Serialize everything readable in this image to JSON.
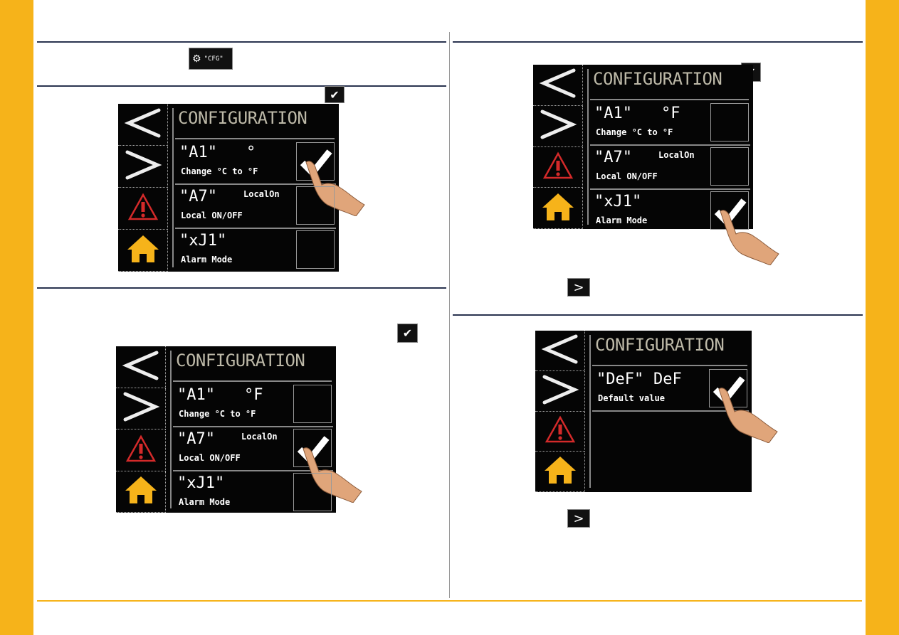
{
  "colors": {
    "accent": "#f6b31a",
    "screen_bg": "#050505",
    "title": "#bdb9a8",
    "alert": "#d42a2a",
    "home": "#f6b31a"
  },
  "left": {
    "cfg_button": {
      "label": "\"CFG\"",
      "icon": "gears-icon"
    },
    "screen1": {
      "title": "CONFIGURATION",
      "rows": [
        {
          "code": "\"A1\"",
          "value": "°",
          "desc": "Change °C to °F",
          "checked": true,
          "touched": true
        },
        {
          "code": "\"A7\"",
          "value": "LocalOn",
          "desc": "Local ON/OFF",
          "checked": false
        },
        {
          "code": "\"xJ1\"",
          "value": "",
          "desc": "Alarm Mode",
          "checked": false
        }
      ]
    },
    "screen2": {
      "title": "CONFIGURATION",
      "rows": [
        {
          "code": "\"A1\"",
          "value": "°F",
          "desc": "Change °C to °F",
          "checked": false
        },
        {
          "code": "\"A7\"",
          "value": "LocalOn",
          "desc": "Local ON/OFF",
          "checked": true,
          "touched": true
        },
        {
          "code": "\"xJ1\"",
          "value": "",
          "desc": "Alarm Mode",
          "checked": false
        }
      ]
    }
  },
  "right": {
    "screen3": {
      "title": "CONFIGURATION",
      "rows": [
        {
          "code": "\"A1\"",
          "value": "°F",
          "desc": "Change °C to °F",
          "checked": false
        },
        {
          "code": "\"A7\"",
          "value": "LocalOn",
          "desc": "Local ON/OFF",
          "checked": false
        },
        {
          "code": "\"xJ1\"",
          "value": "",
          "desc": "Alarm Mode",
          "checked": true,
          "touched": true
        }
      ]
    },
    "screen4": {
      "title": "CONFIGURATION",
      "rows": [
        {
          "code": "\"DeF\"",
          "value": "DeF",
          "desc": "Default value",
          "checked": true,
          "touched": true
        }
      ]
    }
  },
  "nav_icons": [
    "chevron-left-icon",
    "chevron-right-icon",
    "alarm-icon",
    "home-icon"
  ]
}
